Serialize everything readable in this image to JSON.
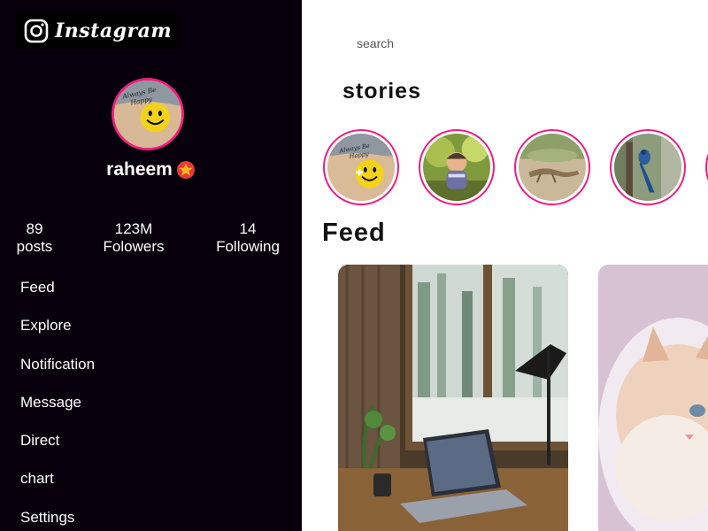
{
  "app": {
    "logo_text": "Instagram"
  },
  "profile": {
    "name": "raheem",
    "picture_text": [
      "Always Be",
      "Happy"
    ],
    "stats": [
      {
        "value": "89",
        "label": "posts"
      },
      {
        "value": "123M",
        "label": "Folowers"
      },
      {
        "value": "14",
        "label": "Following"
      }
    ]
  },
  "nav": {
    "items": [
      {
        "label": "Feed"
      },
      {
        "label": "Explore"
      },
      {
        "label": "Notification"
      },
      {
        "label": "Message"
      },
      {
        "label": "Direct"
      },
      {
        "label": "chart"
      },
      {
        "label": "Settings"
      }
    ]
  },
  "search": {
    "placeholder": "search"
  },
  "stories": {
    "title": "stories",
    "items": [
      {
        "subject": "happy smiley"
      },
      {
        "subject": "baby"
      },
      {
        "subject": "lizard"
      },
      {
        "subject": "blue bird"
      },
      {
        "subject": "partial story"
      }
    ]
  },
  "feed": {
    "title": "Feed",
    "posts": [
      {
        "subject": "laptop on desk by window"
      },
      {
        "subject": "white kitten"
      }
    ]
  },
  "colors": {
    "sidebar_bg": "#07000c",
    "story_ring": "#ee1e80",
    "text_dark": "#111111"
  },
  "icons": {
    "logo": "instagram-camera-icon",
    "badge": "star-badge-icon"
  }
}
